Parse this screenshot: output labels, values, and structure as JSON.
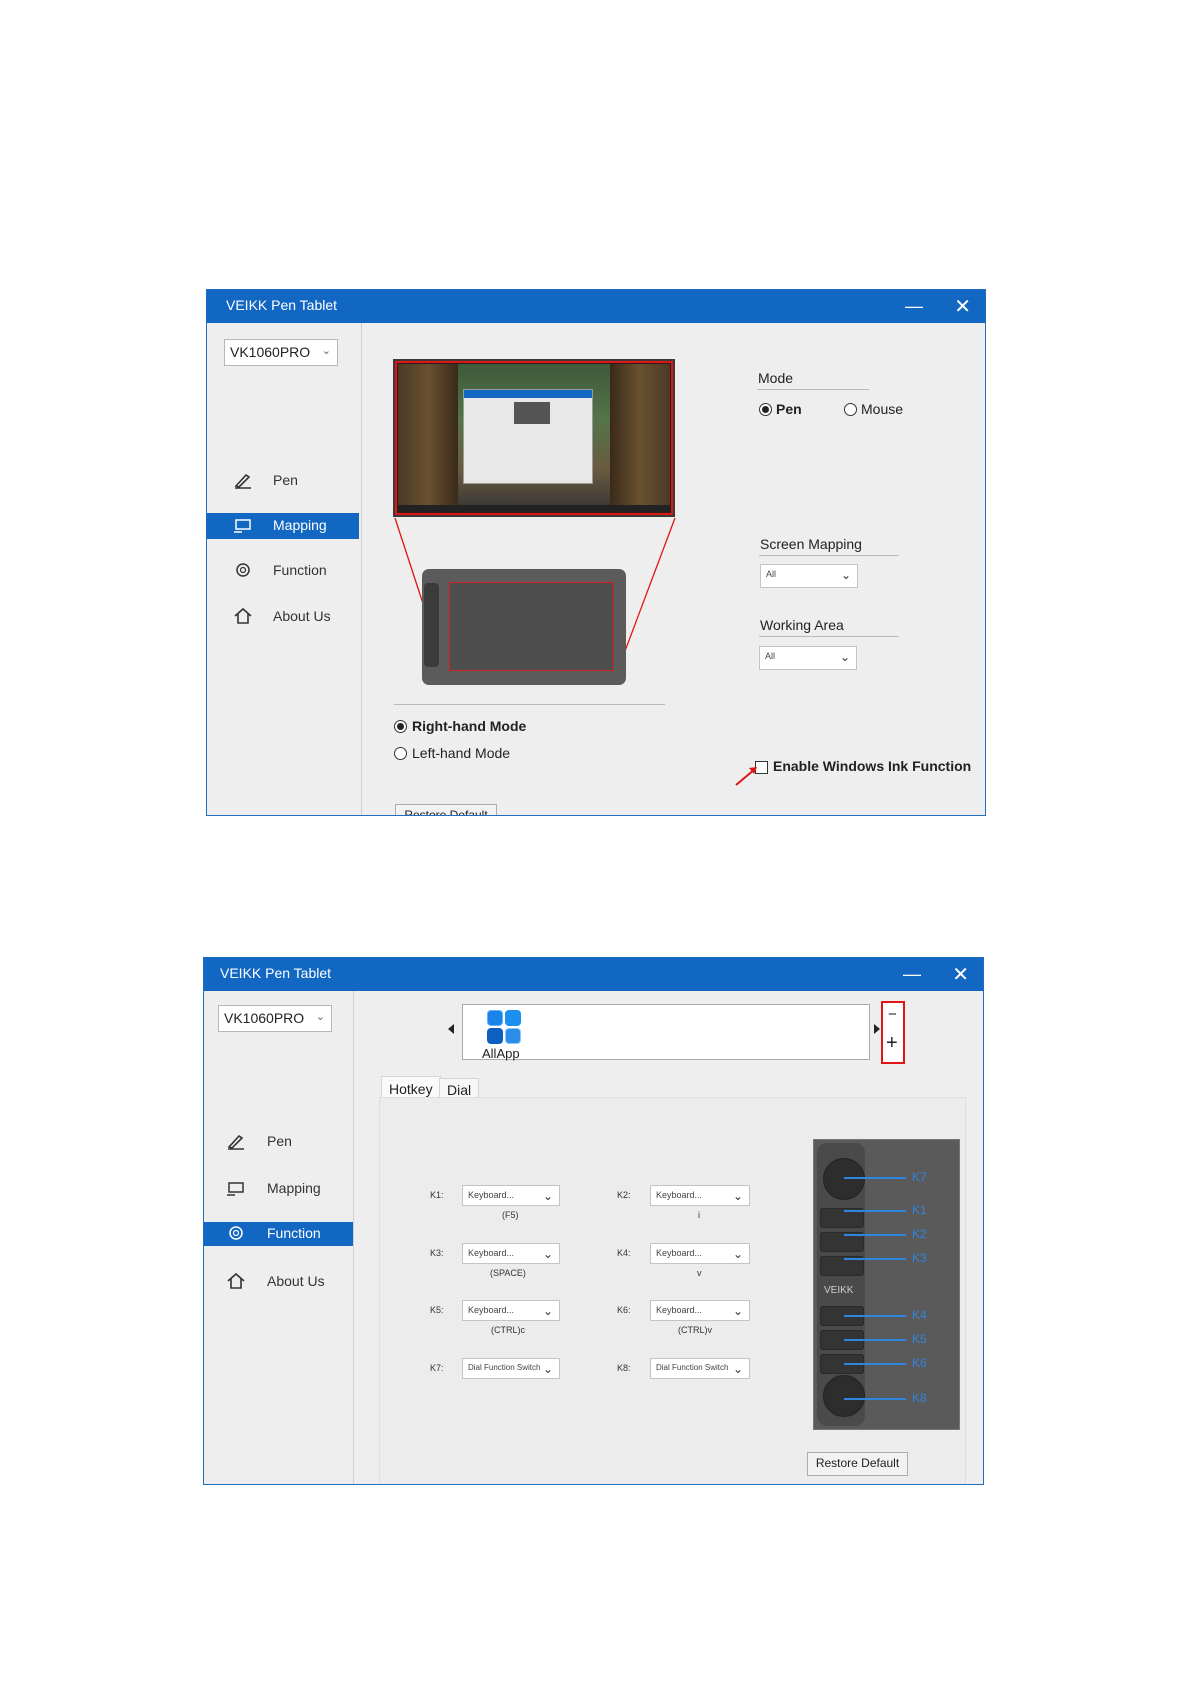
{
  "window1": {
    "title": "VEIKK Pen Tablet",
    "device": "VK1060PRO",
    "nav": [
      "Pen",
      "Mapping",
      "Function",
      "About Us"
    ],
    "mode_label": "Mode",
    "mode_pen": "Pen",
    "mode_mouse": "Mouse",
    "screen_mapping_label": "Screen Mapping",
    "screen_mapping_value": "All",
    "working_area_label": "Working Area",
    "working_area_value": "All",
    "right_hand": "Right-hand Mode",
    "left_hand": "Left-hand Mode",
    "ink": "Enable Windows Ink Function",
    "restore": "Restore Default"
  },
  "window2": {
    "title": "VEIKK Pen Tablet",
    "device": "VK1060PRO",
    "nav": [
      "Pen",
      "Mapping",
      "Function",
      "About Us"
    ],
    "app_label": "AllApp",
    "minus": "−",
    "plus": "+",
    "tabs": [
      "Hotkey",
      "Dial"
    ],
    "keys": [
      {
        "k": "K1:",
        "v": "Keyboard...",
        "s": "(F5)"
      },
      {
        "k": "K2:",
        "v": "Keyboard...",
        "s": "i"
      },
      {
        "k": "K3:",
        "v": "Keyboard...",
        "s": "(SPACE)"
      },
      {
        "k": "K4:",
        "v": "Keyboard...",
        "s": "v"
      },
      {
        "k": "K5:",
        "v": "Keyboard...",
        "s": "(CTRL)c"
      },
      {
        "k": "K6:",
        "v": "Keyboard...",
        "s": "(CTRL)v"
      },
      {
        "k": "K7:",
        "v": "Dial Function Switch",
        "s": ""
      },
      {
        "k": "K8:",
        "v": "Dial Function Switch",
        "s": ""
      }
    ],
    "device_logo": "VEIKK",
    "device_keys": [
      "K7",
      "K1",
      "K2",
      "K3",
      "K4",
      "K5",
      "K6",
      "K8"
    ],
    "restore": "Restore Default"
  },
  "colors": {
    "titlebar": "#1167c2",
    "accent_line": "#2f86e0",
    "highlight": "#e01515"
  }
}
